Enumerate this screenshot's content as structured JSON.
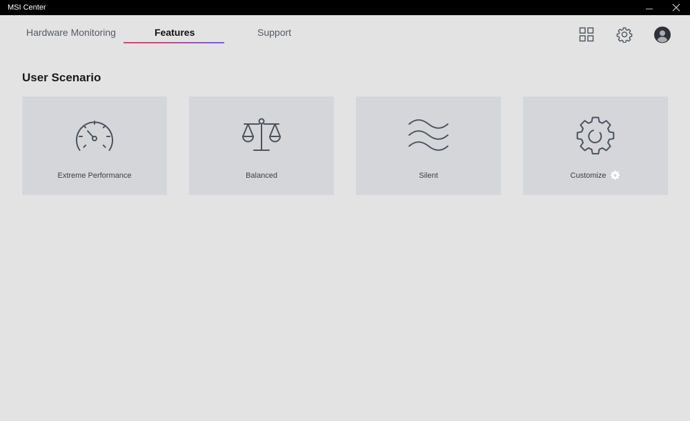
{
  "window": {
    "title": "MSI Center"
  },
  "nav": {
    "tabs": [
      {
        "label": "Hardware Monitoring"
      },
      {
        "label": "Features"
      },
      {
        "label": "Support"
      }
    ],
    "active_tab": "Features"
  },
  "top_icons": {
    "grid": "grid-icon",
    "settings": "gear-icon",
    "user": "user-avatar-icon"
  },
  "section": {
    "title": "User Scenario"
  },
  "scenarios": [
    {
      "label": "Extreme Performance",
      "icon": "speedometer-icon"
    },
    {
      "label": "Balanced",
      "icon": "scale-icon"
    },
    {
      "label": "Silent",
      "icon": "waves-icon"
    },
    {
      "label": "Customize",
      "icon": "gear-icon"
    }
  ],
  "colors": {
    "background": "#e3e3e3",
    "titlebar": "#000000",
    "card": "#d4d6da",
    "icon_stroke": "#4b525b",
    "tab_underline_start": "#e0455a",
    "tab_underline_end": "#7a5ad8"
  }
}
